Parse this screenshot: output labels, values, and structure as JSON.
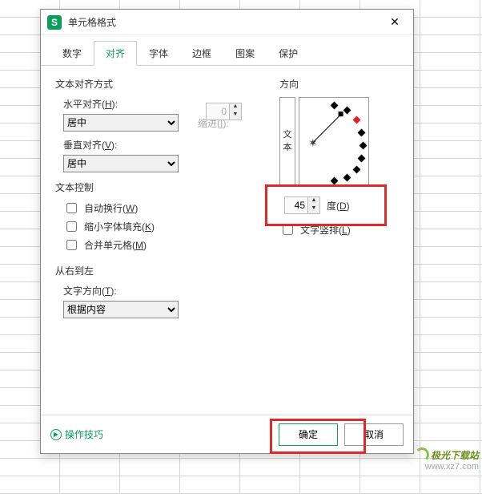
{
  "dialog": {
    "title": "单元格格式",
    "tabs": [
      "数字",
      "对齐",
      "字体",
      "边框",
      "图案",
      "保护"
    ],
    "activeTab": 1,
    "align": {
      "groupLabel": "文本对齐方式",
      "hLabel": "水平对齐(H):",
      "hValue": "居中",
      "indentLabel": "缩进(I):",
      "indentValue": "0",
      "vLabel": "垂直对齐(V):",
      "vValue": "居中"
    },
    "control": {
      "groupLabel": "文本控制",
      "wrap": "自动换行(W)",
      "shrink": "缩小字体填充(K)",
      "merge": "合并单元格(M)"
    },
    "rtl": {
      "groupLabel": "从右到左",
      "dirLabel": "文字方向(T):",
      "dirValue": "根据内容"
    },
    "orient": {
      "groupLabel": "方向",
      "verticalText": "文本",
      "degreeValue": "45",
      "degreeLabel": "度(D)",
      "stackLabel": "文字竖排(L)"
    },
    "footer": {
      "tips": "操作技巧",
      "ok": "确定",
      "cancel": "取消"
    }
  },
  "watermark": {
    "line1": "极光下载站",
    "line2": "www.xz7.com"
  }
}
